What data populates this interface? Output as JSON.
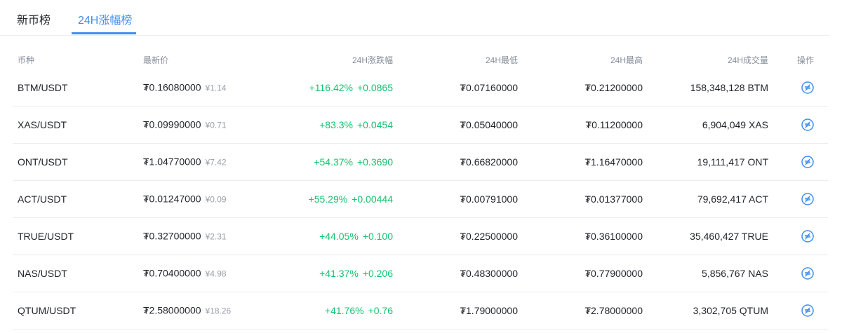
{
  "tabs": [
    {
      "label": "新币榜",
      "active": false
    },
    {
      "label": "24H涨幅榜",
      "active": true
    }
  ],
  "columns": {
    "pair": "币种",
    "price": "最新价",
    "change": "24H涨跌幅",
    "low": "24H最低",
    "high": "24H最高",
    "volume": "24H成交量",
    "action": "操作"
  },
  "rows": [
    {
      "pair": "BTM/USDT",
      "price": "₮0.16080000",
      "cny": "¥1.14",
      "change_pct": "+116.42%",
      "change_abs": "+0.0865",
      "low": "₮0.07160000",
      "high": "₮0.21200000",
      "volume": "158,348,128 BTM"
    },
    {
      "pair": "XAS/USDT",
      "price": "₮0.09990000",
      "cny": "¥0.71",
      "change_pct": "+83.3%",
      "change_abs": "+0.0454",
      "low": "₮0.05040000",
      "high": "₮0.11200000",
      "volume": "6,904,049 XAS"
    },
    {
      "pair": "ONT/USDT",
      "price": "₮1.04770000",
      "cny": "¥7.42",
      "change_pct": "+54.37%",
      "change_abs": "+0.3690",
      "low": "₮0.66820000",
      "high": "₮1.16470000",
      "volume": "19,111,417 ONT"
    },
    {
      "pair": "ACT/USDT",
      "price": "₮0.01247000",
      "cny": "¥0.09",
      "change_pct": "+55.29%",
      "change_abs": "+0.00444",
      "low": "₮0.00791000",
      "high": "₮0.01377000",
      "volume": "79,692,417 ACT"
    },
    {
      "pair": "TRUE/USDT",
      "price": "₮0.32700000",
      "cny": "¥2.31",
      "change_pct": "+44.05%",
      "change_abs": "+0.100",
      "low": "₮0.22500000",
      "high": "₮0.36100000",
      "volume": "35,460,427 TRUE"
    },
    {
      "pair": "NAS/USDT",
      "price": "₮0.70400000",
      "cny": "¥4.98",
      "change_pct": "+41.37%",
      "change_abs": "+0.206",
      "low": "₮0.48300000",
      "high": "₮0.77900000",
      "volume": "5,856,767 NAS"
    },
    {
      "pair": "QTUM/USDT",
      "price": "₮2.58000000",
      "cny": "¥18.26",
      "change_pct": "+41.76%",
      "change_abs": "+0.76",
      "low": "₮1.79000000",
      "high": "₮2.78000000",
      "volume": "3,302,705 QTUM"
    }
  ],
  "colors": {
    "accent": "#3d8ef2",
    "up": "#14c36e",
    "muted": "#868e9b",
    "divider": "#ebedf0"
  },
  "icons": {
    "action": "trade-swap-icon"
  }
}
